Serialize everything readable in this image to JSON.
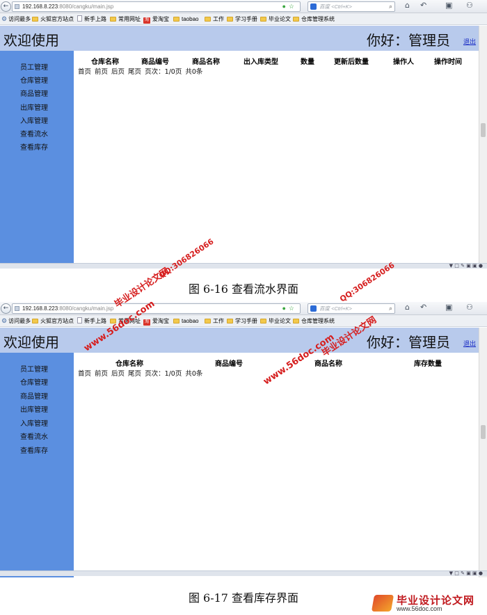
{
  "browser": {
    "url_host": "192.168.8.223",
    "url_path": ":8080/cangku/main.jsp",
    "search_placeholder": "百度 <Ctrl+K>",
    "bookmarks": [
      "访问最多",
      "火狐官方站点",
      "新手上路",
      "常用网址",
      "爱淘宝",
      "taobao",
      "工作",
      "学习手册",
      "毕业论文",
      "仓库管理系统"
    ]
  },
  "app": {
    "welcome": "欢迎使用",
    "greeting": "你好：管理员",
    "logout": "退出"
  },
  "sidebar": {
    "items": [
      "员工管理",
      "仓库管理",
      "商品管理",
      "出库管理",
      "入库管理",
      "查看流水",
      "查看库存"
    ]
  },
  "pager": {
    "first": "首页",
    "prev": "前页",
    "next": "后页",
    "last": "尾页",
    "page_info": "页次：1/0页",
    "total": "共0条"
  },
  "screen1": {
    "columns": [
      "仓库名称",
      "商品编号",
      "商品名称",
      "出入库类型",
      "数量",
      "更新后数量",
      "操作人",
      "操作时间"
    ],
    "caption": "图 6-16  查看流水界面"
  },
  "screen2": {
    "columns": [
      "仓库名称",
      "商品编号",
      "商品名称",
      "库存数量"
    ],
    "caption": "图 6-17  查看库存界面"
  },
  "watermark": {
    "site_cn": "毕业设计论文网",
    "site_url": "www.56doc.com",
    "qq": "QQ:306826066",
    "logo_url": "www.56doc.com"
  }
}
